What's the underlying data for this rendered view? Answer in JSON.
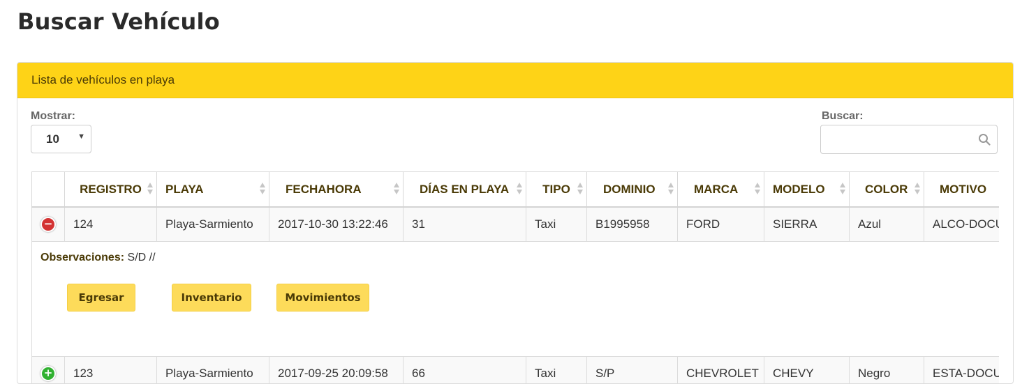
{
  "page": {
    "title": "Buscar Vehículo"
  },
  "panel": {
    "heading": "Lista de vehículos en playa"
  },
  "controls": {
    "length_label": "Mostrar:",
    "length_value": "10",
    "search_label": "Buscar:",
    "search_value": ""
  },
  "table": {
    "columns": [
      "REGISTRO",
      "PLAYA",
      "FECHAHORA",
      "DÍAS EN PLAYA",
      "TIPO",
      "DOMINIO",
      "MARCA",
      "MODELO",
      "COLOR",
      "MOTIVO"
    ],
    "rows": [
      {
        "expanded": true,
        "cells": [
          "124",
          "Playa-Sarmiento",
          "2017-10-30 13:22:46",
          "31",
          "Taxi",
          "B1995958",
          "FORD",
          "SIERRA",
          "Azul",
          "ALCO-DOCU"
        ]
      },
      {
        "expanded": false,
        "cells": [
          "123",
          "Playa-Sarmiento",
          "2017-09-25 20:09:58",
          "66",
          "Taxi",
          "S/P",
          "CHEVROLET",
          "CHEVY",
          "Negro",
          "ESTA-DOCU"
        ]
      }
    ],
    "detail": {
      "obs_label": "Observaciones:",
      "obs_value": "S/D //",
      "buttons": {
        "egresar": "Egresar",
        "inventario": "Inventario",
        "movimientos": "Movimientos"
      }
    }
  },
  "icons": {
    "search": "search-icon",
    "collapse": "minus-circle-icon",
    "expand": "plus-circle-icon",
    "caret": "caret-down-icon"
  },
  "colors": {
    "accent": "#fed317",
    "button": "#fddb5a",
    "text_dark": "#4a3a06",
    "minus": "#d33333",
    "plus": "#31b131"
  }
}
